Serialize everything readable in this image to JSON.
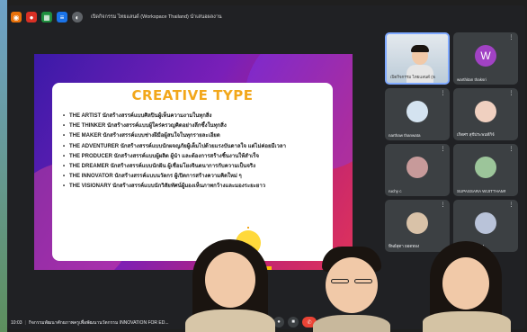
{
  "meeting": {
    "title": "เปิดกิจกรรม ไทยแลนด์ (Workspace Thailand) นำเสนอผลงาน",
    "clock": "10:03",
    "name": "กิจกรรมพัฒนาศักยภาพครูเพื่อพัฒนานวัตกรรม INNOVATION FOR ED..."
  },
  "slide": {
    "title": "CREATIVE TYPE",
    "items": [
      "THE ARTIST นักสร้างสรรค์แบบศิลปินผู้เห็นความงามในทุกสิ่ง",
      "THE THINKER นักสร้างสรรค์แบบผู้ใคร่ครวญคิดอย่างลึกซึ้งในทุกสิ่ง",
      "THE MAKER นักสร้างสรรค์แบบช่างฝีมือผู้สนใจในทุกรายละเอียด",
      "THE ADVENTURER นักสร้างสรรค์แบบนักผจญภัยผู้เต็มไปด้วยแรงบันดาลใจ แต่ไม่ค่อยมีเวลา",
      "THE PRODUCER นักสร้างสรรค์แบบผู้ผลิต ผู้นำ และต้องการสร้างชิ้นงานให้สำเร็จ",
      "THE DREAMER นักสร้างสรรค์แบบนักฝัน ผู้เชื่อมโยงจินตนาการกับความเป็นจริง",
      "THE INNOVATOR นักสร้างสรรค์แบบนวัตกร ผู้เปิดการสร้างความคิดใหม่ ๆ",
      "THE VISIONARY นักสร้างสรรค์แบบนักวิสัยทัศน์ผู้มองเห็นภาพกว้างและมองระยะยาว"
    ]
  },
  "participants": [
    {
      "name": "เปิดกิจกรรม ไทยแลนด์ (Workspace...",
      "avatar": ""
    },
    {
      "name": "warthitan thaksri",
      "avatar": "W"
    },
    {
      "name": "narthaw thanwata",
      "avatar": ""
    },
    {
      "name": "เกิดศร สุขีประพนท์กิจ์",
      "avatar": ""
    },
    {
      "name": "ruchy c",
      "avatar": ""
    },
    {
      "name": "SUPASSARA WIJITTHAMMAKUL",
      "avatar": ""
    },
    {
      "name": "ทิพย์สุดา ยอดทอง",
      "avatar": ""
    },
    {
      "name": "ปิยะ ศรีทองแดง",
      "avatar": ""
    }
  ],
  "colors": {
    "accent": "#7fa9ff",
    "end_call": "#ea4335",
    "slide_title": "#f2a71b"
  }
}
